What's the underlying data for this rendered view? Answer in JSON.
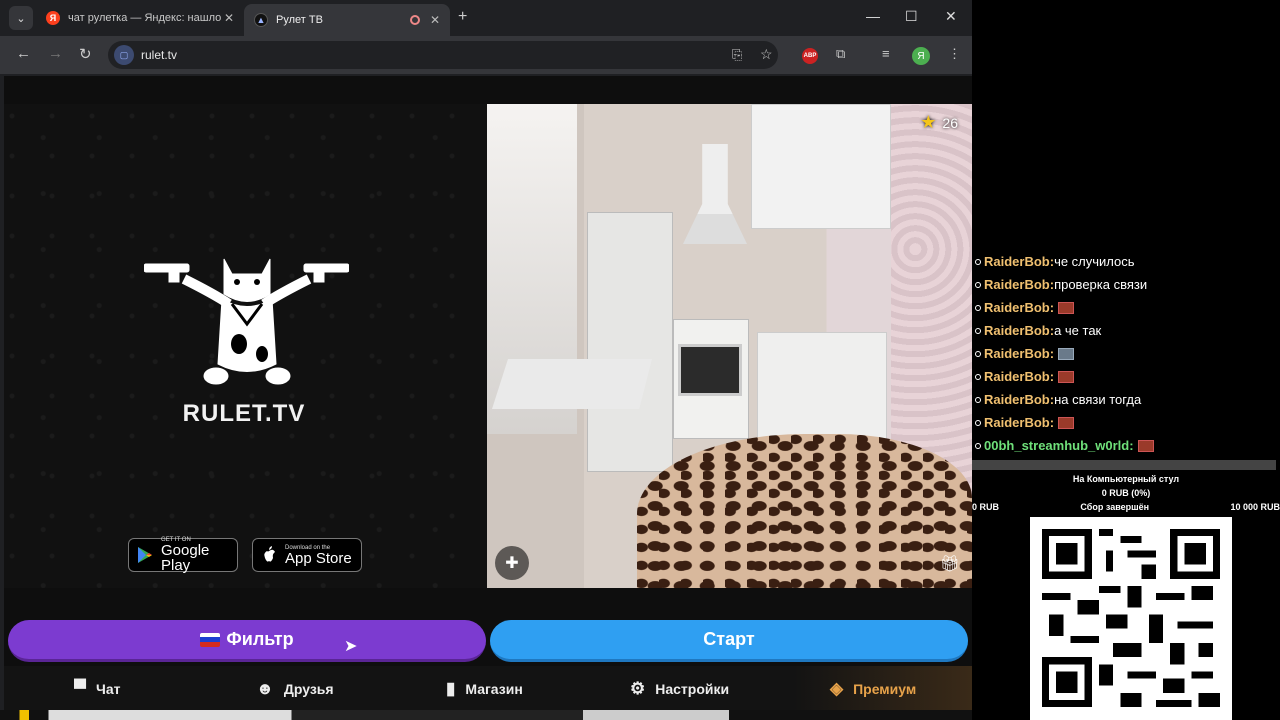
{
  "browser": {
    "tabs": [
      {
        "title": "чат рулетка — Яндекс: нашло",
        "favicon": "Я",
        "active": false
      },
      {
        "title": "Рулет ТВ",
        "favicon": "R",
        "active": true
      }
    ],
    "url": "rulet.tv",
    "profile_letter": "Я",
    "abp_label": "ABP"
  },
  "page": {
    "logo_text": "RULET.TV",
    "google_play": {
      "small": "GET IT ON",
      "big": "Google Play"
    },
    "app_store": {
      "small": "Download on the",
      "big": "App Store"
    },
    "video": {
      "star_count": "26"
    },
    "filter_button": "Фильтр",
    "start_button": "Старт",
    "nav": [
      {
        "label": "Чат",
        "icon": "chat-icon"
      },
      {
        "label": "Друзья",
        "icon": "friends-icon"
      },
      {
        "label": "Магазин",
        "icon": "shop-bag-icon"
      },
      {
        "label": "Настройки",
        "icon": "gear-icon"
      },
      {
        "label": "Премиум",
        "icon": "premium-tag-icon"
      }
    ],
    "colors": {
      "filter": "#7c3bd0",
      "start": "#2f9ff2",
      "premium": "#e7a24a"
    }
  },
  "overlay": {
    "chat": [
      {
        "user": "RaiderBob:",
        "msg": "че случилось",
        "emote": false
      },
      {
        "user": "RaiderBob:",
        "msg": "проверка связи",
        "emote": false
      },
      {
        "user": "RaiderBob:",
        "msg": "",
        "emote": true
      },
      {
        "user": "RaiderBob:",
        "msg": "а че так",
        "emote": false
      },
      {
        "user": "RaiderBob:",
        "msg": "",
        "emote": true
      },
      {
        "user": "RaiderBob:",
        "msg": "",
        "emote": true
      },
      {
        "user": "RaiderBob:",
        "msg": "на связи тогда",
        "emote": false
      },
      {
        "user": "RaiderBob:",
        "msg": "",
        "emote": true
      },
      {
        "user": "00bh_streamhub_w0rld:",
        "msg": "",
        "emote": true
      }
    ],
    "donation": {
      "title": "На Компьютерный стул",
      "amount": "0 RUB (0%)",
      "min": "0 RUB",
      "status": "Сбор завершён",
      "max": "10 000 RUB",
      "progress": 0
    }
  }
}
